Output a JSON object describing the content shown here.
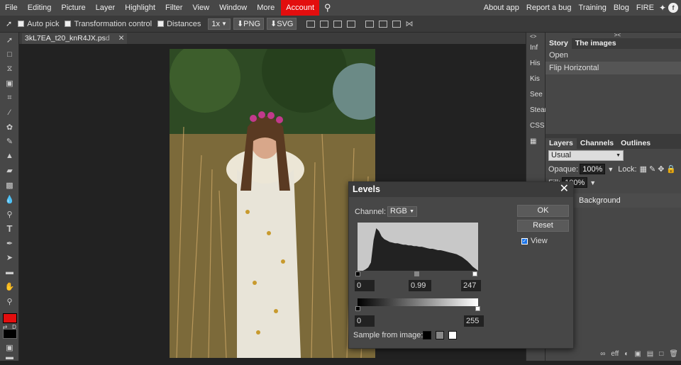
{
  "menu": {
    "items": [
      "File",
      "Editing",
      "Picture",
      "Layer",
      "Highlight",
      "Filter",
      "View",
      "Window",
      "More"
    ],
    "account": "Account",
    "right_items": [
      "About app",
      "Report a bug",
      "Training",
      "Blog",
      "FIRE"
    ]
  },
  "toolbar": {
    "auto_pick": "Auto pick",
    "transformation_control": "Transformation control",
    "distances": "Distances",
    "zoom": "1x",
    "png": "PNG",
    "svg": "SVG"
  },
  "document": {
    "tab_name": "3kL7EA_t20_knR4JX.ps",
    "tab_ext": "d"
  },
  "mini_panels": [
    "Inf",
    "His",
    "Kis",
    "See",
    "Stearn",
    "CSS"
  ],
  "history_panel": {
    "tabs": [
      "Story",
      "The images"
    ],
    "items": [
      "Open",
      "Flip Horizontal"
    ]
  },
  "layers_panel": {
    "tabs": [
      "Layers",
      "Channels",
      "Outlines"
    ],
    "blend_mode": "Usual",
    "opaque_label": "Opaque:",
    "opaque_value": "100%",
    "lock_label": "Lock:",
    "fill_label": "Fill:",
    "fill_value": "100%",
    "layer_name": "Background",
    "bottom_eff": "eff"
  },
  "levels": {
    "title": "Levels",
    "channel_label": "Channel:",
    "channel_value": "RGB",
    "ok": "OK",
    "reset": "Reset",
    "view_label": "View",
    "input_black": "0",
    "input_gamma": "0.99",
    "input_white": "247",
    "output_black": "0",
    "output_white": "255",
    "sample_label": "Sample from image:",
    "histogram": [
      0,
      0,
      0,
      2,
      5,
      12,
      45,
      62,
      58,
      50,
      46,
      44,
      42,
      41,
      40,
      40,
      39,
      38,
      38,
      37,
      37,
      36,
      36,
      35,
      35,
      34,
      33,
      32,
      32,
      31,
      30,
      30,
      29,
      28,
      27,
      26,
      25,
      24,
      22,
      20,
      17,
      14,
      10,
      6,
      3,
      0
    ]
  },
  "colors": {
    "accent": "#e30e0e",
    "panel": "#474747",
    "background": "#222222"
  }
}
